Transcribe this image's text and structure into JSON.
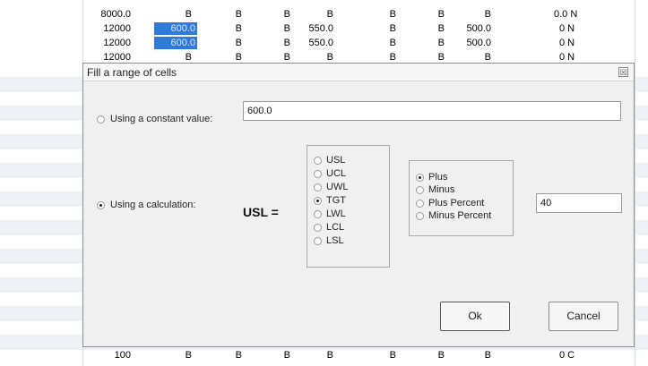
{
  "sheet": {
    "top_rows": [
      [
        "8000.0",
        "B",
        "B",
        "B",
        "B",
        "B",
        "B",
        "B",
        "0.0 N"
      ],
      [
        "12000",
        "600.0",
        "B",
        "B",
        "550.0",
        "B",
        "B",
        "500.0",
        "0 N"
      ],
      [
        "12000",
        "600.0",
        "B",
        "B",
        "550.0",
        "B",
        "B",
        "500.0",
        "0 N"
      ],
      [
        "12000",
        "B",
        "B",
        "B",
        "B",
        "B",
        "B",
        "B",
        "0 N"
      ]
    ],
    "bottom_rows": [
      [
        "100",
        "B",
        "B",
        "B",
        "B",
        "B",
        "B",
        "B",
        "0 C"
      ]
    ]
  },
  "dialog": {
    "title": "Fill a range of cells",
    "close_label": "☒",
    "constant_label": "Using a constant value:",
    "constant_value": "600.0",
    "constant_selected": false,
    "calc_label": "Using a calculation:",
    "calc_selected": true,
    "usl_eq": "USL  =",
    "limit_options": [
      "USL",
      "UCL",
      "UWL",
      "TGT",
      "LWL",
      "LCL",
      "LSL"
    ],
    "limit_selected": "TGT",
    "op_options": [
      "Plus",
      "Minus",
      "Plus Percent",
      "Minus Percent"
    ],
    "op_selected": "Plus",
    "calc_value": "40",
    "ok_label": "Ok",
    "cancel_label": "Cancel"
  }
}
